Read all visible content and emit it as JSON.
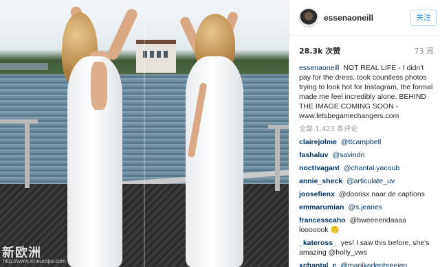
{
  "header": {
    "username": "essenaoneill",
    "follow_label": "关注"
  },
  "stats": {
    "likes": "28.3k 次赞",
    "age": "73 周"
  },
  "caption": {
    "user": "essenaoneill",
    "text": "NOT REAL LIFE - I didn't pay for the dress, took countless photos trying to look hot for Instagram, the formal made me feel incredibly alone. BEHIND THE IMAGE COMING SOON - www.letsbegamechangers.com"
  },
  "all_comments_label": "全部 1,423 条评论",
  "comments": [
    {
      "user": "clairejolme",
      "text": "@ttcampbell"
    },
    {
      "user": "fashaluv",
      "text": "@savindri"
    },
    {
      "user": "noctivagant",
      "text": "@chantal.yacoub"
    },
    {
      "user": "annie_sheck",
      "text": "@articulate_uv"
    },
    {
      "user": "joosefienx",
      "text": "@doorisx naar de captions"
    },
    {
      "user": "emmarumian",
      "text": "@s.jeanes"
    },
    {
      "user": "francesscaho",
      "text": "@bweeeendaaaa looooook 🙃"
    },
    {
      "user": "_kateross_",
      "text": "yes! I saw this before, she's amazing @holly_vws"
    },
    {
      "user": "xchantal_c",
      "text": "@marijkedenbreejen"
    }
  ],
  "watermark": {
    "text": "新欧洲",
    "url": "http://www.xineurope.com"
  },
  "colors": {
    "link": "#003569",
    "follow_text": "#3897f0",
    "muted": "#999999"
  }
}
